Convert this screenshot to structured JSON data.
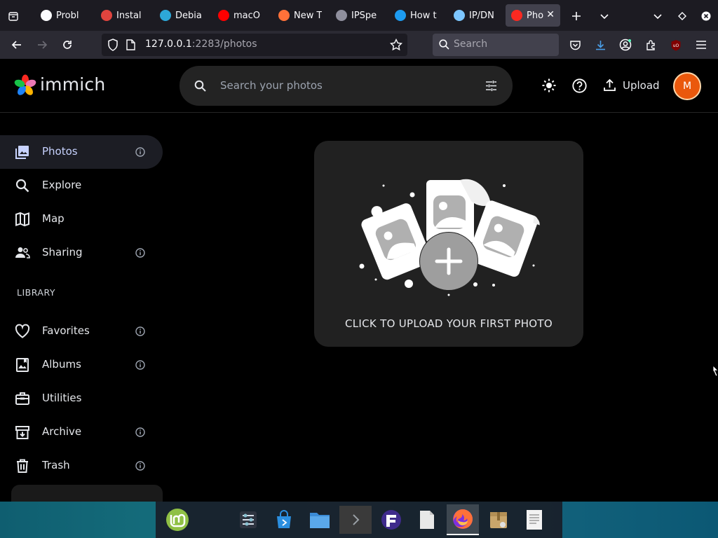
{
  "browser": {
    "tabs": [
      {
        "title": "Probl",
        "favicon": "info-icon",
        "color": "#fbfbfe"
      },
      {
        "title": "Instal",
        "favicon": "chrome-icon",
        "color": "#e0443e"
      },
      {
        "title": "Debia",
        "favicon": "debian-icon",
        "color": "#2da8d8"
      },
      {
        "title": "macO",
        "favicon": "youtube-icon",
        "color": "#ff0000"
      },
      {
        "title": "New T",
        "favicon": "firefox-icon",
        "color": "#ff7139"
      },
      {
        "title": "IPSpe",
        "favicon": "ipspeed-icon",
        "color": "#8f8f9d"
      },
      {
        "title": "How t",
        "favicon": "bird-icon",
        "color": "#1d9bf0"
      },
      {
        "title": "IP/DN",
        "favicon": "network-icon",
        "color": "#7cc6ff"
      },
      {
        "title": "Pho",
        "favicon": "immich-icon",
        "color": "#fa2921",
        "active": true
      }
    ],
    "url_host": "127.0.0.1",
    "url_path": ":2283/photos",
    "search_placeholder": "Search"
  },
  "app": {
    "name": "immich",
    "search_placeholder": "Search your photos",
    "upload_label": "Upload",
    "avatar_initial": "M"
  },
  "sidebar": {
    "items": [
      {
        "label": "Photos",
        "icon": "photos-icon",
        "info": true,
        "active": true
      },
      {
        "label": "Explore",
        "icon": "magnify-icon",
        "info": false
      },
      {
        "label": "Map",
        "icon": "map-icon",
        "info": false
      },
      {
        "label": "Sharing",
        "icon": "sharing-icon",
        "info": true
      }
    ],
    "library_heading": "LIBRARY",
    "library_items": [
      {
        "label": "Favorites",
        "icon": "heart-icon",
        "info": true
      },
      {
        "label": "Albums",
        "icon": "album-icon",
        "info": true
      },
      {
        "label": "Utilities",
        "icon": "toolbox-icon",
        "info": false
      },
      {
        "label": "Archive",
        "icon": "archive-icon",
        "info": true
      },
      {
        "label": "Trash",
        "icon": "trash-icon",
        "info": true
      }
    ]
  },
  "main": {
    "upload_prompt": "CLICK TO UPLOAD YOUR FIRST PHOTO"
  },
  "taskbar": {
    "apps": [
      "mint-menu-icon",
      "system-settings-icon",
      "software-store-icon",
      "files-icon",
      "terminal-icon",
      "filezilla-icon",
      "text-file-icon",
      "firefox-icon",
      "archive-manager-icon",
      "text-editor-icon"
    ],
    "active_app": "firefox-icon"
  },
  "colors": {
    "accent": "#c7d2fe",
    "avatar": "#ea580c",
    "card": "#212121"
  }
}
